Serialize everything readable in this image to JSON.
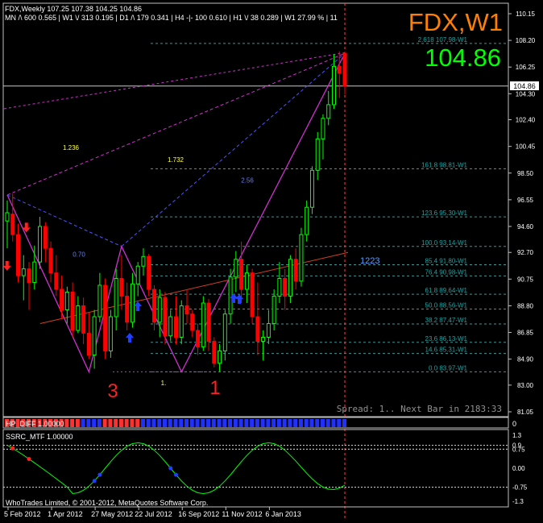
{
  "header": {
    "symbol_line": "FDX,Weekly  107.25 107.38 104.25 104.86",
    "tf_line": "MN /\\ 600   0.565 | W1 \\/ 313   0.195 | D1 /\\ 179   0.341 | H4 -|- 100   0.610 | H1 \\/ 38   0.289 | W1  27.99 % | 11"
  },
  "big_title": "FDX,W1",
  "big_price": "104.86",
  "current_price_tag": "104.86",
  "spread_text": "Spread: 1.. Next Bar in 2183:33",
  "copyright": "WhoTrades Limited, © 2001-2012, MetaQuotes Software Corp.",
  "wave_labels": [
    "3",
    "1"
  ],
  "indicator1_label": "HP_DIFF 1.00000",
  "indicator2_label": "SSRC_MTF 1.00000",
  "colors": {
    "background": "#000000",
    "bull_candle": "#00ff00",
    "bear_candle": "#ff0000",
    "fib_level": "#1fa3a3",
    "pattern_line": "#d030d0",
    "axis_text": "#ffffff",
    "price_line": "#c8c8c8",
    "title": "#ff7f00",
    "price_green": "#00ff00",
    "ssrc_line": "#00ff00"
  },
  "chart_data": [
    {
      "type": "candlestick",
      "title": "FDX,Weekly",
      "ylim": [
        81.05,
        110.15
      ],
      "y_ticks": [
        "110.15",
        "108.20",
        "106.25",
        "104.30",
        "102.40",
        "100.45",
        "98.50",
        "96.55",
        "94.60",
        "92.70",
        "90.75",
        "88.80",
        "86.85",
        "84.90",
        "83.00",
        "81.05"
      ],
      "x_ticks": [
        "5 Feb 2012",
        "1 Apr 2012",
        "27 May 2012",
        "22 Jul 2012",
        "16 Sep 2012",
        "11 Nov 2012",
        "6 Jan 2013"
      ],
      "candles": [
        {
          "o": 95.0,
          "h": 96.5,
          "l": 93.0,
          "c": 95.6
        },
        {
          "o": 95.5,
          "h": 97.0,
          "l": 93.5,
          "c": 94.0
        },
        {
          "o": 94.0,
          "h": 94.8,
          "l": 90.5,
          "c": 91.0
        },
        {
          "o": 91.0,
          "h": 92.5,
          "l": 89.2,
          "c": 91.5
        },
        {
          "o": 91.5,
          "h": 92.0,
          "l": 88.5,
          "c": 90.5
        },
        {
          "o": 90.5,
          "h": 93.2,
          "l": 90.0,
          "c": 92.0
        },
        {
          "o": 92.0,
          "h": 95.3,
          "l": 91.5,
          "c": 94.6
        },
        {
          "o": 94.6,
          "h": 94.9,
          "l": 92.0,
          "c": 93.0
        },
        {
          "o": 93.0,
          "h": 93.5,
          "l": 90.5,
          "c": 91.2
        },
        {
          "o": 91.2,
          "h": 92.5,
          "l": 89.5,
          "c": 90.0
        },
        {
          "o": 90.0,
          "h": 91.0,
          "l": 87.8,
          "c": 88.5
        },
        {
          "o": 88.5,
          "h": 90.2,
          "l": 87.5,
          "c": 89.8
        },
        {
          "o": 89.8,
          "h": 90.5,
          "l": 86.5,
          "c": 87.0
        },
        {
          "o": 87.0,
          "h": 89.5,
          "l": 86.8,
          "c": 88.8
        },
        {
          "o": 88.8,
          "h": 89.4,
          "l": 86.0,
          "c": 86.8
        },
        {
          "o": 86.8,
          "h": 88.3,
          "l": 84.9,
          "c": 85.2
        },
        {
          "o": 85.2,
          "h": 88.5,
          "l": 84.2,
          "c": 88.0
        },
        {
          "o": 88.0,
          "h": 91.2,
          "l": 87.6,
          "c": 90.3
        },
        {
          "o": 90.3,
          "h": 90.8,
          "l": 84.9,
          "c": 85.5
        },
        {
          "o": 85.5,
          "h": 88.5,
          "l": 85.0,
          "c": 88.0
        },
        {
          "o": 88.0,
          "h": 91.5,
          "l": 87.0,
          "c": 90.8
        },
        {
          "o": 90.8,
          "h": 92.5,
          "l": 88.5,
          "c": 89.5
        },
        {
          "o": 89.5,
          "h": 90.5,
          "l": 87.0,
          "c": 87.6
        },
        {
          "o": 87.6,
          "h": 91.2,
          "l": 87.2,
          "c": 90.4
        },
        {
          "o": 90.4,
          "h": 92.0,
          "l": 89.5,
          "c": 91.7
        },
        {
          "o": 91.7,
          "h": 93.0,
          "l": 91.0,
          "c": 92.4
        },
        {
          "o": 92.4,
          "h": 92.6,
          "l": 89.5,
          "c": 90.0
        },
        {
          "o": 90.0,
          "h": 90.3,
          "l": 87.0,
          "c": 87.6
        },
        {
          "o": 87.6,
          "h": 90.0,
          "l": 86.5,
          "c": 89.4
        },
        {
          "o": 89.4,
          "h": 89.8,
          "l": 86.0,
          "c": 86.6
        },
        {
          "o": 86.6,
          "h": 88.5,
          "l": 86.2,
          "c": 88.0
        },
        {
          "o": 88.0,
          "h": 89.5,
          "l": 86.0,
          "c": 86.5
        },
        {
          "o": 86.5,
          "h": 89.2,
          "l": 86.0,
          "c": 88.8
        },
        {
          "o": 88.8,
          "h": 90.0,
          "l": 87.5,
          "c": 88.2
        },
        {
          "o": 88.2,
          "h": 88.5,
          "l": 86.5,
          "c": 87.0
        },
        {
          "o": 87.0,
          "h": 87.5,
          "l": 85.2,
          "c": 85.8
        },
        {
          "o": 85.8,
          "h": 89.5,
          "l": 85.5,
          "c": 89.0
        },
        {
          "o": 89.0,
          "h": 89.3,
          "l": 85.5,
          "c": 86.2
        },
        {
          "o": 86.2,
          "h": 86.5,
          "l": 84.3,
          "c": 84.6
        },
        {
          "o": 84.6,
          "h": 86.0,
          "l": 84.0,
          "c": 85.5
        },
        {
          "o": 85.5,
          "h": 88.5,
          "l": 84.8,
          "c": 88.2
        },
        {
          "o": 88.2,
          "h": 91.5,
          "l": 87.5,
          "c": 90.9
        },
        {
          "o": 90.9,
          "h": 92.8,
          "l": 89.8,
          "c": 92.2
        },
        {
          "o": 92.2,
          "h": 93.5,
          "l": 89.0,
          "c": 90.0
        },
        {
          "o": 90.0,
          "h": 91.8,
          "l": 89.0,
          "c": 91.2
        },
        {
          "o": 91.2,
          "h": 91.5,
          "l": 87.5,
          "c": 88.0
        },
        {
          "o": 88.0,
          "h": 90.5,
          "l": 85.2,
          "c": 86.2
        },
        {
          "o": 86.2,
          "h": 87.0,
          "l": 84.8,
          "c": 86.5
        },
        {
          "o": 86.5,
          "h": 88.5,
          "l": 86.0,
          "c": 87.5
        },
        {
          "o": 87.5,
          "h": 90.0,
          "l": 87.0,
          "c": 89.5
        },
        {
          "o": 89.5,
          "h": 92.0,
          "l": 89.0,
          "c": 90.8
        },
        {
          "o": 90.8,
          "h": 91.5,
          "l": 88.5,
          "c": 89.5
        },
        {
          "o": 89.5,
          "h": 92.5,
          "l": 89.0,
          "c": 92.2
        },
        {
          "o": 92.2,
          "h": 93.0,
          "l": 90.0,
          "c": 90.6
        },
        {
          "o": 90.6,
          "h": 94.5,
          "l": 90.2,
          "c": 94.0
        },
        {
          "o": 94.0,
          "h": 96.5,
          "l": 93.5,
          "c": 96.0
        },
        {
          "o": 96.0,
          "h": 99.0,
          "l": 95.5,
          "c": 98.7
        },
        {
          "o": 98.7,
          "h": 101.5,
          "l": 98.0,
          "c": 101.0
        },
        {
          "o": 101.0,
          "h": 102.8,
          "l": 99.5,
          "c": 102.5
        },
        {
          "o": 102.5,
          "h": 104.5,
          "l": 102.0,
          "c": 103.5
        },
        {
          "o": 103.5,
          "h": 107.2,
          "l": 103.2,
          "c": 106.3
        },
        {
          "o": 106.3,
          "h": 107.4,
          "l": 104.0,
          "c": 105.8
        },
        {
          "o": 107.25,
          "h": 107.38,
          "l": 104.25,
          "c": 104.86
        }
      ],
      "fib_levels": [
        {
          "label": "2.618 107.98-W1",
          "value": 107.98
        },
        {
          "label": "161.8 98.81-W1",
          "value": 98.81
        },
        {
          "label": "123.6 95.30-W1",
          "value": 95.3
        },
        {
          "label": "100.0 93.14-W1",
          "value": 93.14
        },
        {
          "label": "85.4 91.80-W1",
          "value": 91.8
        },
        {
          "label": "76.4 90.98-W1",
          "value": 90.98
        },
        {
          "label": "61.8 89.64-W1",
          "value": 89.64
        },
        {
          "label": "50.0 88.56-W1",
          "value": 88.56
        },
        {
          "label": "38.2 87.47-W1",
          "value": 87.47
        },
        {
          "label": "23.6 86.13-W1",
          "value": 86.13
        },
        {
          "label": "14.6 85.31-W1",
          "value": 85.31
        },
        {
          "label": "0.0 83.97-W1",
          "value": 83.97
        }
      ],
      "ratio_labels": [
        "1.236",
        "1.732",
        "2.56",
        "0.70",
        "1."
      ],
      "trendline_label": "1223",
      "current_price": 104.86
    },
    {
      "type": "bar",
      "title": "HP_DIFF 1.00000",
      "y_ticks": [
        "0"
      ],
      "pattern": "red/blue histogram, red early then blue"
    },
    {
      "type": "line",
      "title": "SSRC_MTF 1.00000",
      "y_ticks": [
        "1.3",
        "0.9",
        "0.75",
        "0.00",
        "-0.75",
        "-1.3"
      ],
      "ylim": [
        -1.3,
        1.3
      ]
    }
  ]
}
